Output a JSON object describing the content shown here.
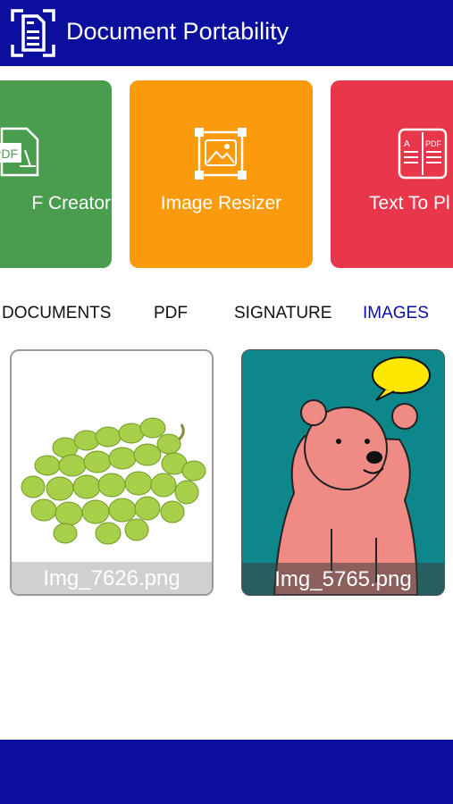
{
  "header": {
    "title": "Document Portability"
  },
  "cards": [
    {
      "label": "F Creator",
      "icon": "pdf-file-icon",
      "color": "#4a9d4e"
    },
    {
      "label": "Image Resizer",
      "icon": "image-resize-icon",
      "color": "#fb9a0c"
    },
    {
      "label": "Text To Pl",
      "icon": "text-to-pdf-book-icon",
      "color": "#e8364a"
    }
  ],
  "tabs": [
    {
      "label": "DOCUMENTS",
      "active": false
    },
    {
      "label": "PDF",
      "active": false
    },
    {
      "label": "SIGNATURE",
      "active": false
    },
    {
      "label": "IMAGES",
      "active": true
    }
  ],
  "images": [
    {
      "name": "Img_7626.png",
      "subject": "grapes"
    },
    {
      "name": "Img_5765.png",
      "subject": "bear-cartoon"
    }
  ],
  "colors": {
    "primary": "#0a0f9e",
    "accent_active_tab": "#0a0f9e"
  }
}
